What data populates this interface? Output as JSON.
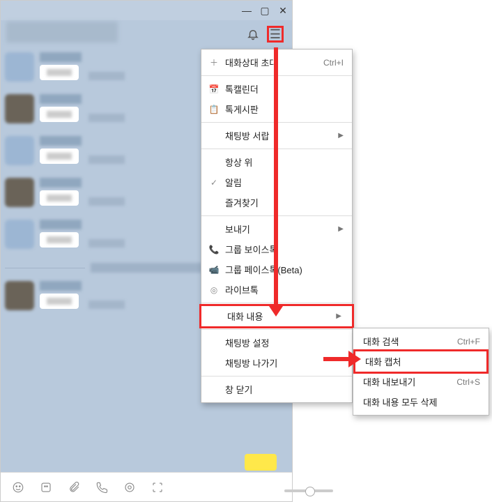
{
  "titlebar": {
    "min": "—",
    "max": "▢",
    "close": "✕"
  },
  "header": {
    "bell_icon": "bell-icon",
    "menu_icon": "hamburger-icon"
  },
  "menu": {
    "items": [
      {
        "icon": "＋",
        "label": "대화상대 초대",
        "shortcut": "Ctrl+I",
        "submenu": false
      },
      {
        "sep": true
      },
      {
        "icon": "📅",
        "label": "톡캘린더",
        "shortcut": "",
        "submenu": false
      },
      {
        "icon": "📋",
        "label": "톡게시판",
        "shortcut": "",
        "submenu": false
      },
      {
        "sep": true
      },
      {
        "icon": "",
        "label": "채팅방 서랍",
        "shortcut": "",
        "submenu": true
      },
      {
        "sep": true
      },
      {
        "icon": "",
        "label": "항상 위",
        "shortcut": "",
        "submenu": false
      },
      {
        "icon": "✓",
        "label": "알림",
        "shortcut": "",
        "submenu": false
      },
      {
        "icon": "",
        "label": "즐겨찾기",
        "shortcut": "",
        "submenu": false
      },
      {
        "sep": true
      },
      {
        "icon": "",
        "label": "보내기",
        "shortcut": "",
        "submenu": true
      },
      {
        "icon": "📞",
        "label": "그룹 보이스톡",
        "shortcut": "",
        "submenu": false
      },
      {
        "icon": "📹",
        "label": "그룹 페이스톡(Beta)",
        "shortcut": "",
        "submenu": false
      },
      {
        "icon": "◎",
        "label": "라이브톡",
        "shortcut": "",
        "submenu": false
      },
      {
        "sep": true
      },
      {
        "icon": "",
        "label": "대화 내용",
        "shortcut": "",
        "submenu": true,
        "highlight": true
      },
      {
        "sep": true
      },
      {
        "icon": "",
        "label": "채팅방 설정",
        "shortcut": "",
        "submenu": false
      },
      {
        "icon": "",
        "label": "채팅방 나가기",
        "shortcut": "",
        "submenu": false
      },
      {
        "sep": true
      },
      {
        "icon": "",
        "label": "창 닫기",
        "shortcut": "",
        "submenu": false
      }
    ]
  },
  "submenu": {
    "items": [
      {
        "label": "대화 검색",
        "shortcut": "Ctrl+F"
      },
      {
        "label": "대화 캡처",
        "shortcut": "",
        "highlight": true
      },
      {
        "label": "대화 내보내기",
        "shortcut": "Ctrl+S"
      },
      {
        "label": "대화 내용 모두 삭제",
        "shortcut": ""
      }
    ]
  },
  "toolbar": {
    "icons": [
      "emoji-icon",
      "sticker-icon",
      "attach-icon",
      "call-icon",
      "live-icon",
      "capture-icon"
    ]
  }
}
